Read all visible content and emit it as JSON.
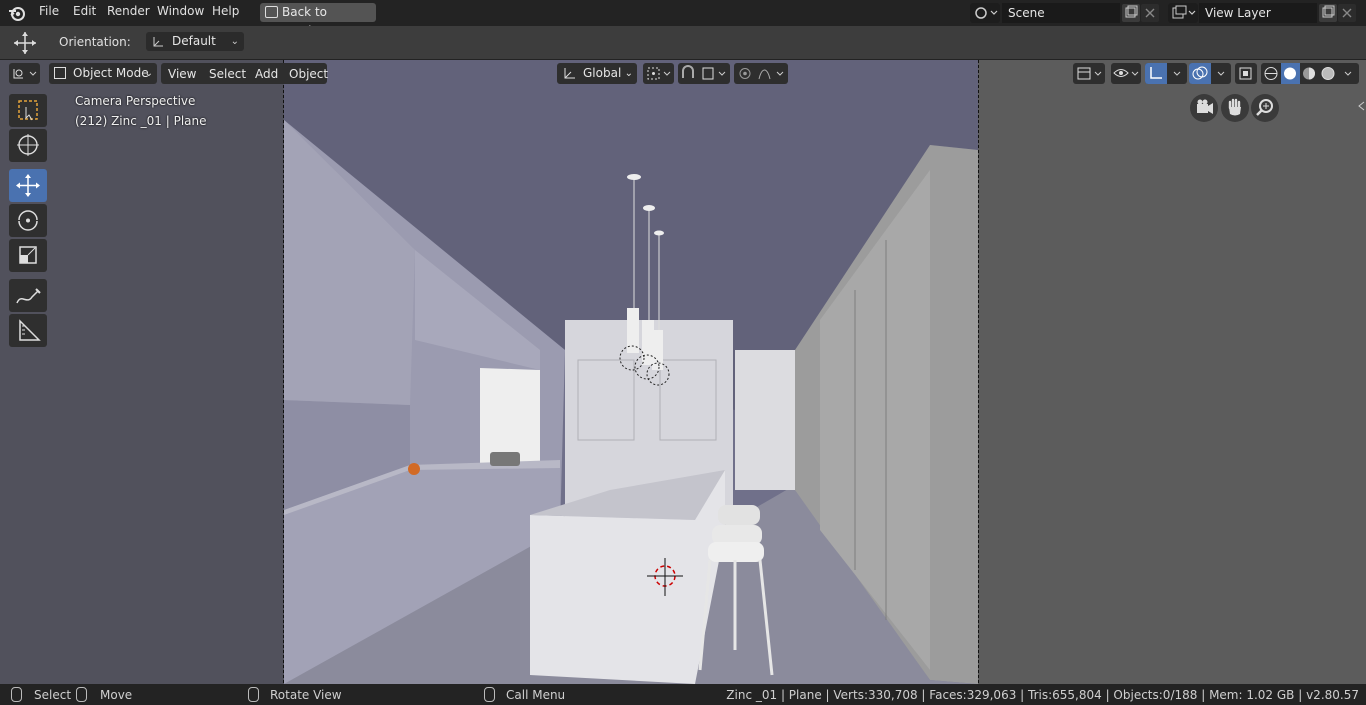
{
  "menu": {
    "items": [
      "File",
      "Edit",
      "Render",
      "Window",
      "Help"
    ],
    "back_button": "Back to Previous",
    "scene": "Scene",
    "view_layer": "View Layer"
  },
  "tool_header": {
    "orientation_label": "Orientation:",
    "orientation_value": "Default"
  },
  "viewport_header": {
    "mode": "Object Mode",
    "menus": [
      "View",
      "Select",
      "Add",
      "Object"
    ],
    "transform_orientation": "Global"
  },
  "viewport": {
    "camera_label": "Camera Perspective",
    "active_object": "(212) Zinc _01 | Plane"
  },
  "status_bar": {
    "select": "Select",
    "move": "Move",
    "rotate_view": "Rotate View",
    "call_menu": "Call Menu",
    "stats": "Zinc _01 | Plane | Verts:330,708 | Faces:329,063 | Tris:655,804 | Objects:0/188 | Mem: 1.02 GB | v2.80.57"
  },
  "colors": {
    "accent": "#4a72b0",
    "viewport_bg": "#5a5a5a",
    "camera_frame": "#6e6e82"
  }
}
